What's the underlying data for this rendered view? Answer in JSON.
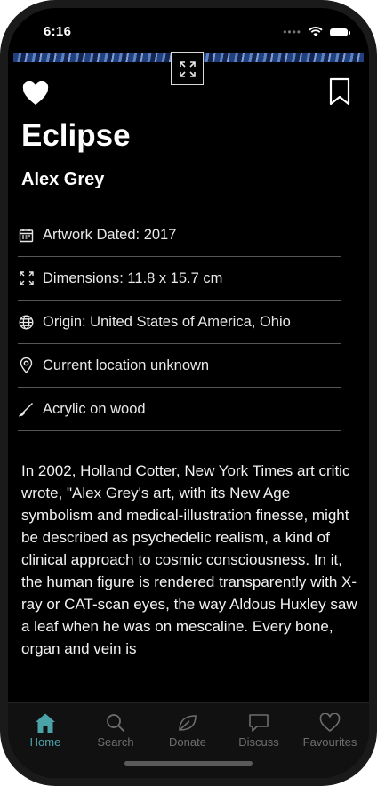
{
  "status_bar": {
    "time": "6:16"
  },
  "artwork": {
    "title": "Eclipse",
    "artist": "Alex Grey"
  },
  "info": [
    {
      "icon": "calendar-icon",
      "text": "Artwork Dated: 2017"
    },
    {
      "icon": "dimensions-icon",
      "text": "Dimensions: 11.8 x 15.7 cm"
    },
    {
      "icon": "globe-icon",
      "text": "Origin: United States of America, Ohio"
    },
    {
      "icon": "location-pin-icon",
      "text": "Current location unknown"
    },
    {
      "icon": "brush-icon",
      "text": "Acrylic on wood"
    }
  ],
  "description": "In 2002, Holland Cotter, New York Times art critic wrote, \"Alex Grey's art, with its New Age symbolism and medical-illustration finesse, might be described as psychedelic realism, a kind of clinical approach to cosmic consciousness. In it, the human figure is rendered transparently with X-ray or CAT-scan eyes, the way Aldous Huxley saw a leaf when he was on mescaline. Every bone, organ and vein is",
  "tabs": [
    {
      "label": "Home",
      "icon": "home-icon",
      "active": true
    },
    {
      "label": "Search",
      "icon": "search-icon",
      "active": false
    },
    {
      "label": "Donate",
      "icon": "leaf-icon",
      "active": false
    },
    {
      "label": "Discuss",
      "icon": "chat-bubble-icon",
      "active": false
    },
    {
      "label": "Favourites",
      "icon": "heart-outline-icon",
      "active": false
    }
  ],
  "colors": {
    "background": "#000000",
    "text": "#ffffff",
    "tab_active": "#4aa3a8",
    "tab_inactive": "#6e6e6e"
  }
}
